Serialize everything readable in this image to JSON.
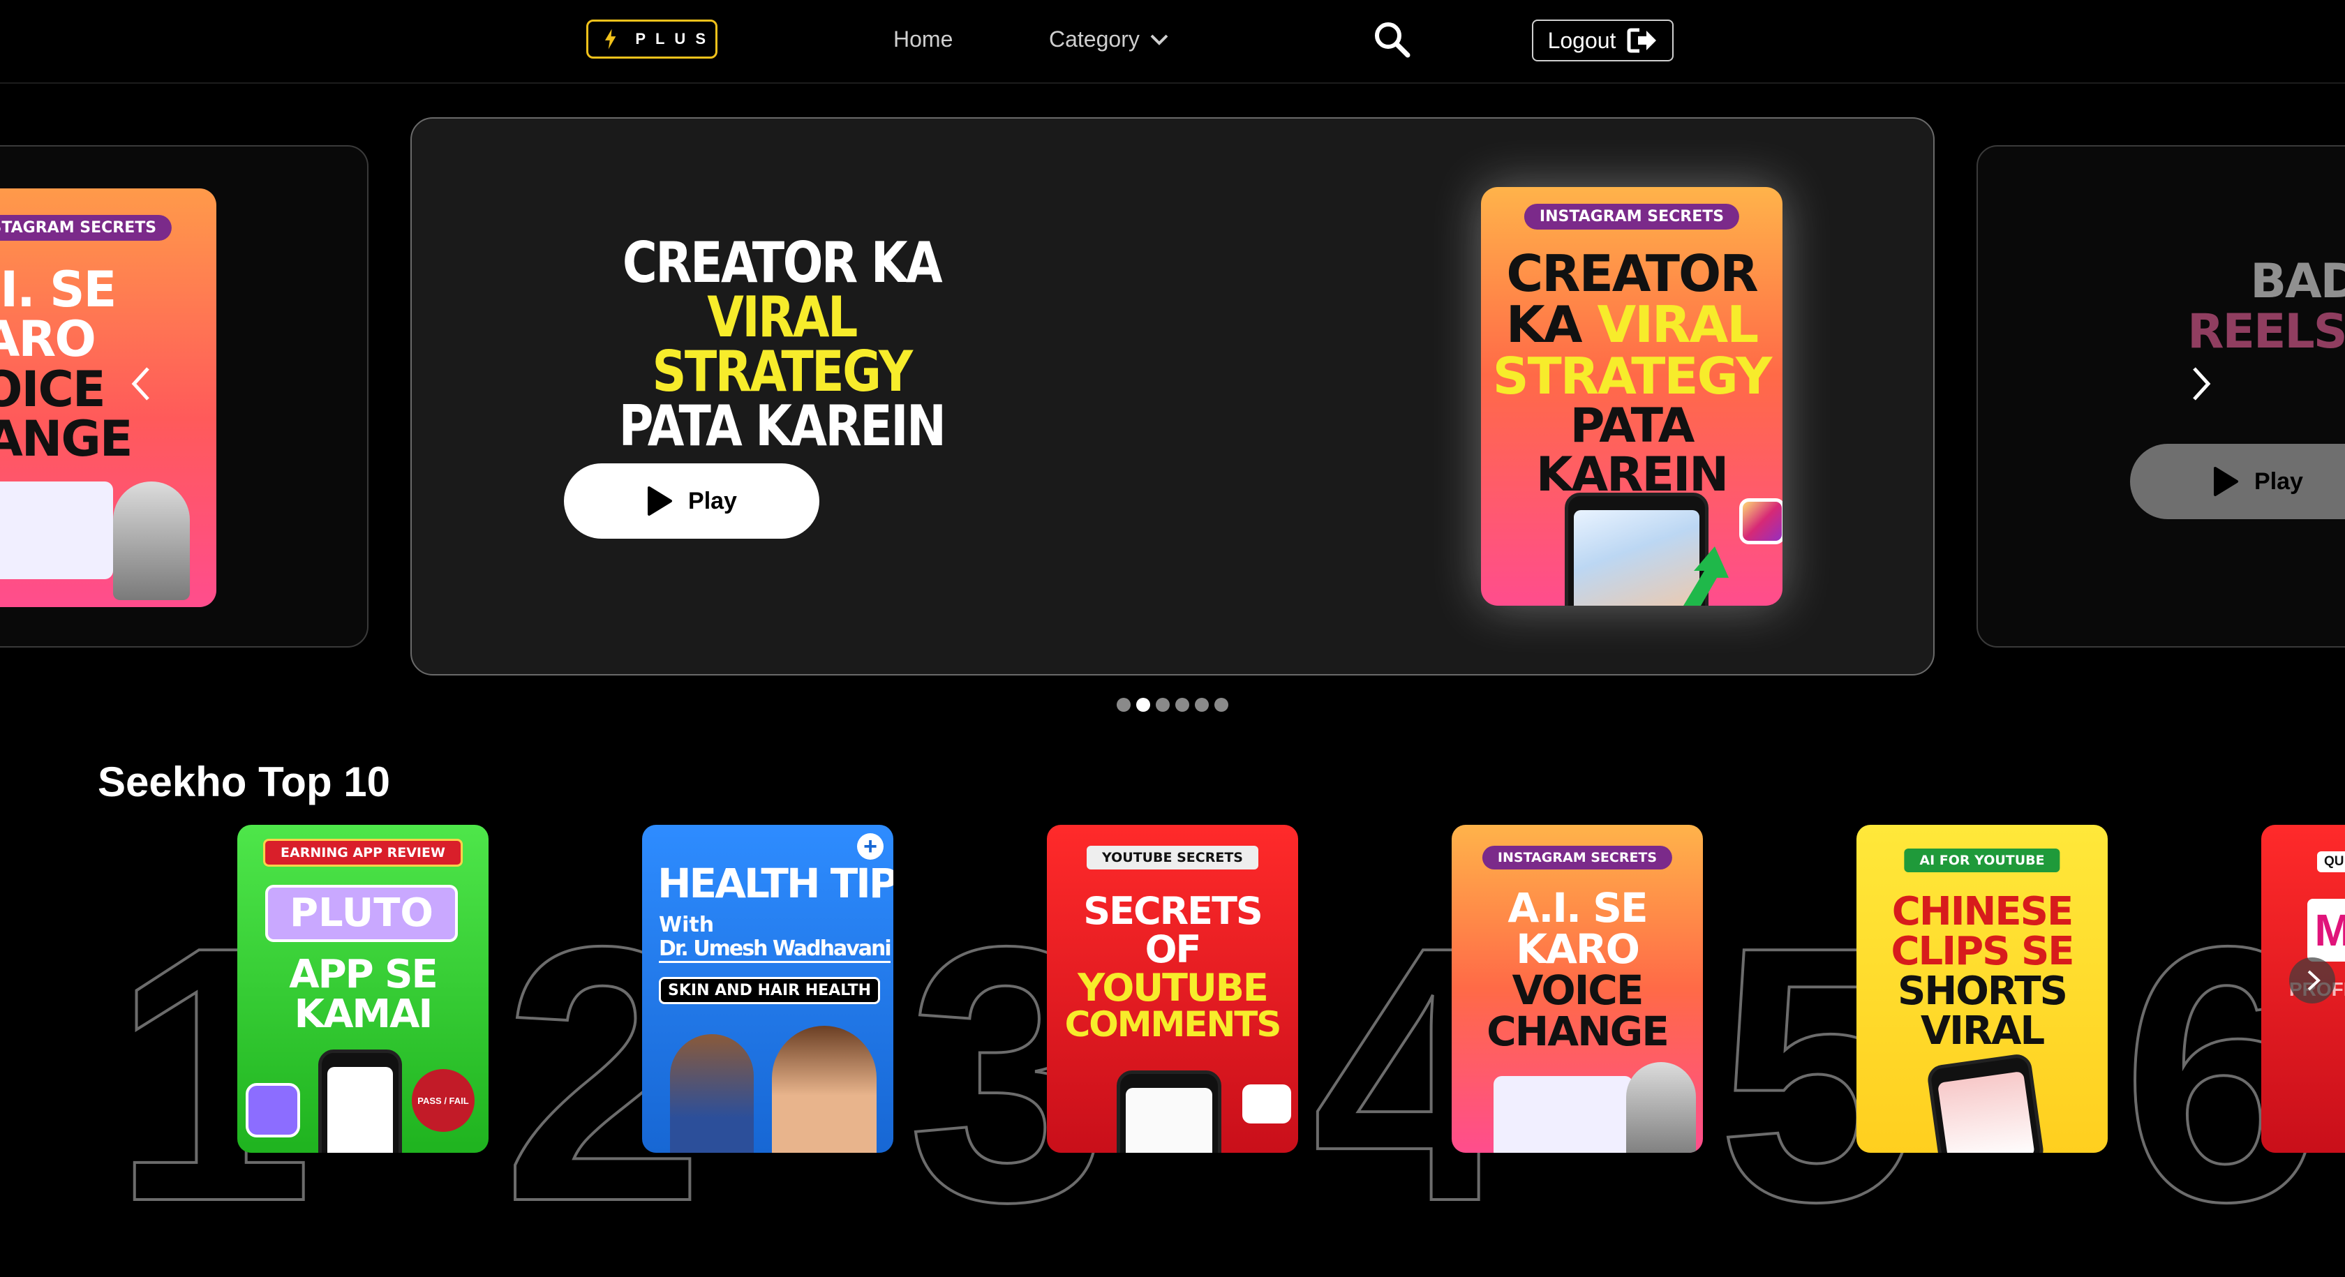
{
  "header": {
    "logo_text": "PLUS",
    "nav": {
      "home": "Home",
      "category": "Category"
    },
    "logout_label": "Logout"
  },
  "hero": {
    "title_line1": "CREATOR KA",
    "title_line2": "VIRAL STRATEGY",
    "title_line3": "PATA KAREIN",
    "play_label": "Play",
    "poster": {
      "tag": "INSTAGRAM SECRETS",
      "line1": "CREATOR",
      "line2a": "KA",
      "line2b": "VIRAL",
      "line3": "STRATEGY",
      "line4": "PATA KAREIN"
    }
  },
  "prev_slide": {
    "tag": "INSTAGRAM SECRETS",
    "line1": "A.I. SE",
    "line2": "KARO",
    "line3": "VOICE",
    "line4": "HANGE"
  },
  "next_slide": {
    "line1": "BADH",
    "line2": "REELS V",
    "play_label": "Play"
  },
  "carousel": {
    "slide_count": 6,
    "active_index": 1
  },
  "top10": {
    "title": "Seekho Top 10",
    "items": [
      {
        "rank": "1",
        "tag": "EARNING APP REVIEW",
        "l1": "PLUTO",
        "l2": "APP SE",
        "l3": "KAMAI",
        "badge": "PASS / FAIL"
      },
      {
        "rank": "2",
        "l1": "HEALTH TIPS",
        "l2": "With",
        "l3": "Dr. Umesh Wadhavani",
        "l4": "SKIN AND HAIR HEALTH"
      },
      {
        "rank": "3",
        "tag": "YOUTUBE SECRETS",
        "l1": "SECRETS",
        "l2": "OF",
        "l3": "YOUTUBE",
        "l4": "COMMENTS"
      },
      {
        "rank": "4",
        "tag": "INSTAGRAM SECRETS",
        "l1": "A.I. SE",
        "l2": "KARO",
        "l3": "VOICE",
        "l4": "CHANGE"
      },
      {
        "rank": "5",
        "tag": "AI FOR YOUTUBE",
        "l1": "CHINESE",
        "l2": "CLIPS SE",
        "l3": "SHORTS",
        "l4": "VIRAL"
      },
      {
        "rank": "6",
        "tag": "QU",
        "l1": "PROFIT"
      }
    ]
  },
  "colors": {
    "accent_yellow": "#f2c21b",
    "viral_yellow": "#f7ec2b",
    "background": "#000000",
    "card_bg": "#1a1a1a"
  },
  "icons": [
    "bolt-icon",
    "chevron-down-icon",
    "search-icon",
    "logout-icon",
    "play-icon",
    "chevron-left-icon",
    "chevron-right-icon"
  ]
}
